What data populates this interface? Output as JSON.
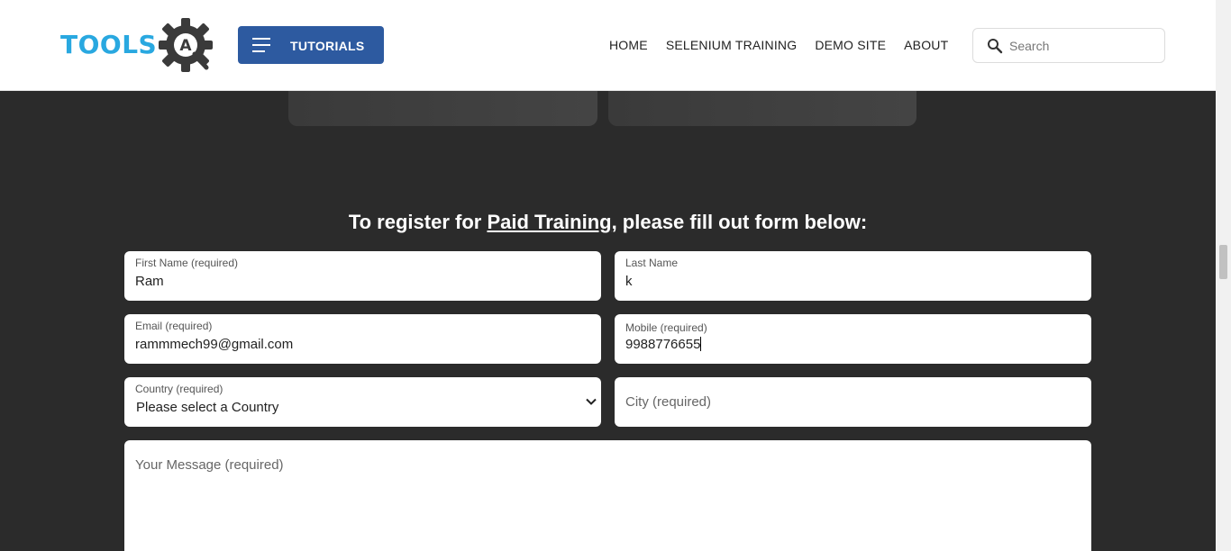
{
  "header": {
    "logo_text": "TOOLS",
    "logo_mark": "A",
    "tutorials_label": "TUTORIALS",
    "nav": [
      "HOME",
      "SELENIUM TRAINING",
      "DEMO SITE",
      "ABOUT"
    ],
    "search_placeholder": "Search"
  },
  "form": {
    "heading_prefix": "To register for ",
    "heading_link": "Paid Training",
    "heading_suffix": ", please fill out form below:",
    "first_name": {
      "label": "First Name (required)",
      "value": "Ram"
    },
    "last_name": {
      "label": "Last Name",
      "value": "k"
    },
    "email": {
      "label": "Email (required)",
      "value": "rammmech99@gmail.com"
    },
    "mobile": {
      "label": "Mobile (required)",
      "value": "9988776655"
    },
    "country": {
      "label": "Country (required)",
      "value": "Please select a Country"
    },
    "city": {
      "placeholder": "City (required)"
    },
    "message": {
      "placeholder": "Your Message (required)"
    }
  },
  "colors": {
    "brand_blue": "#29a8e0",
    "button_blue": "#2d5aa0",
    "dark_bg": "#2b2b2b"
  },
  "icons": [
    "gear-logo-icon",
    "hamburger-icon",
    "search-icon",
    "chevron-down-icon"
  ]
}
